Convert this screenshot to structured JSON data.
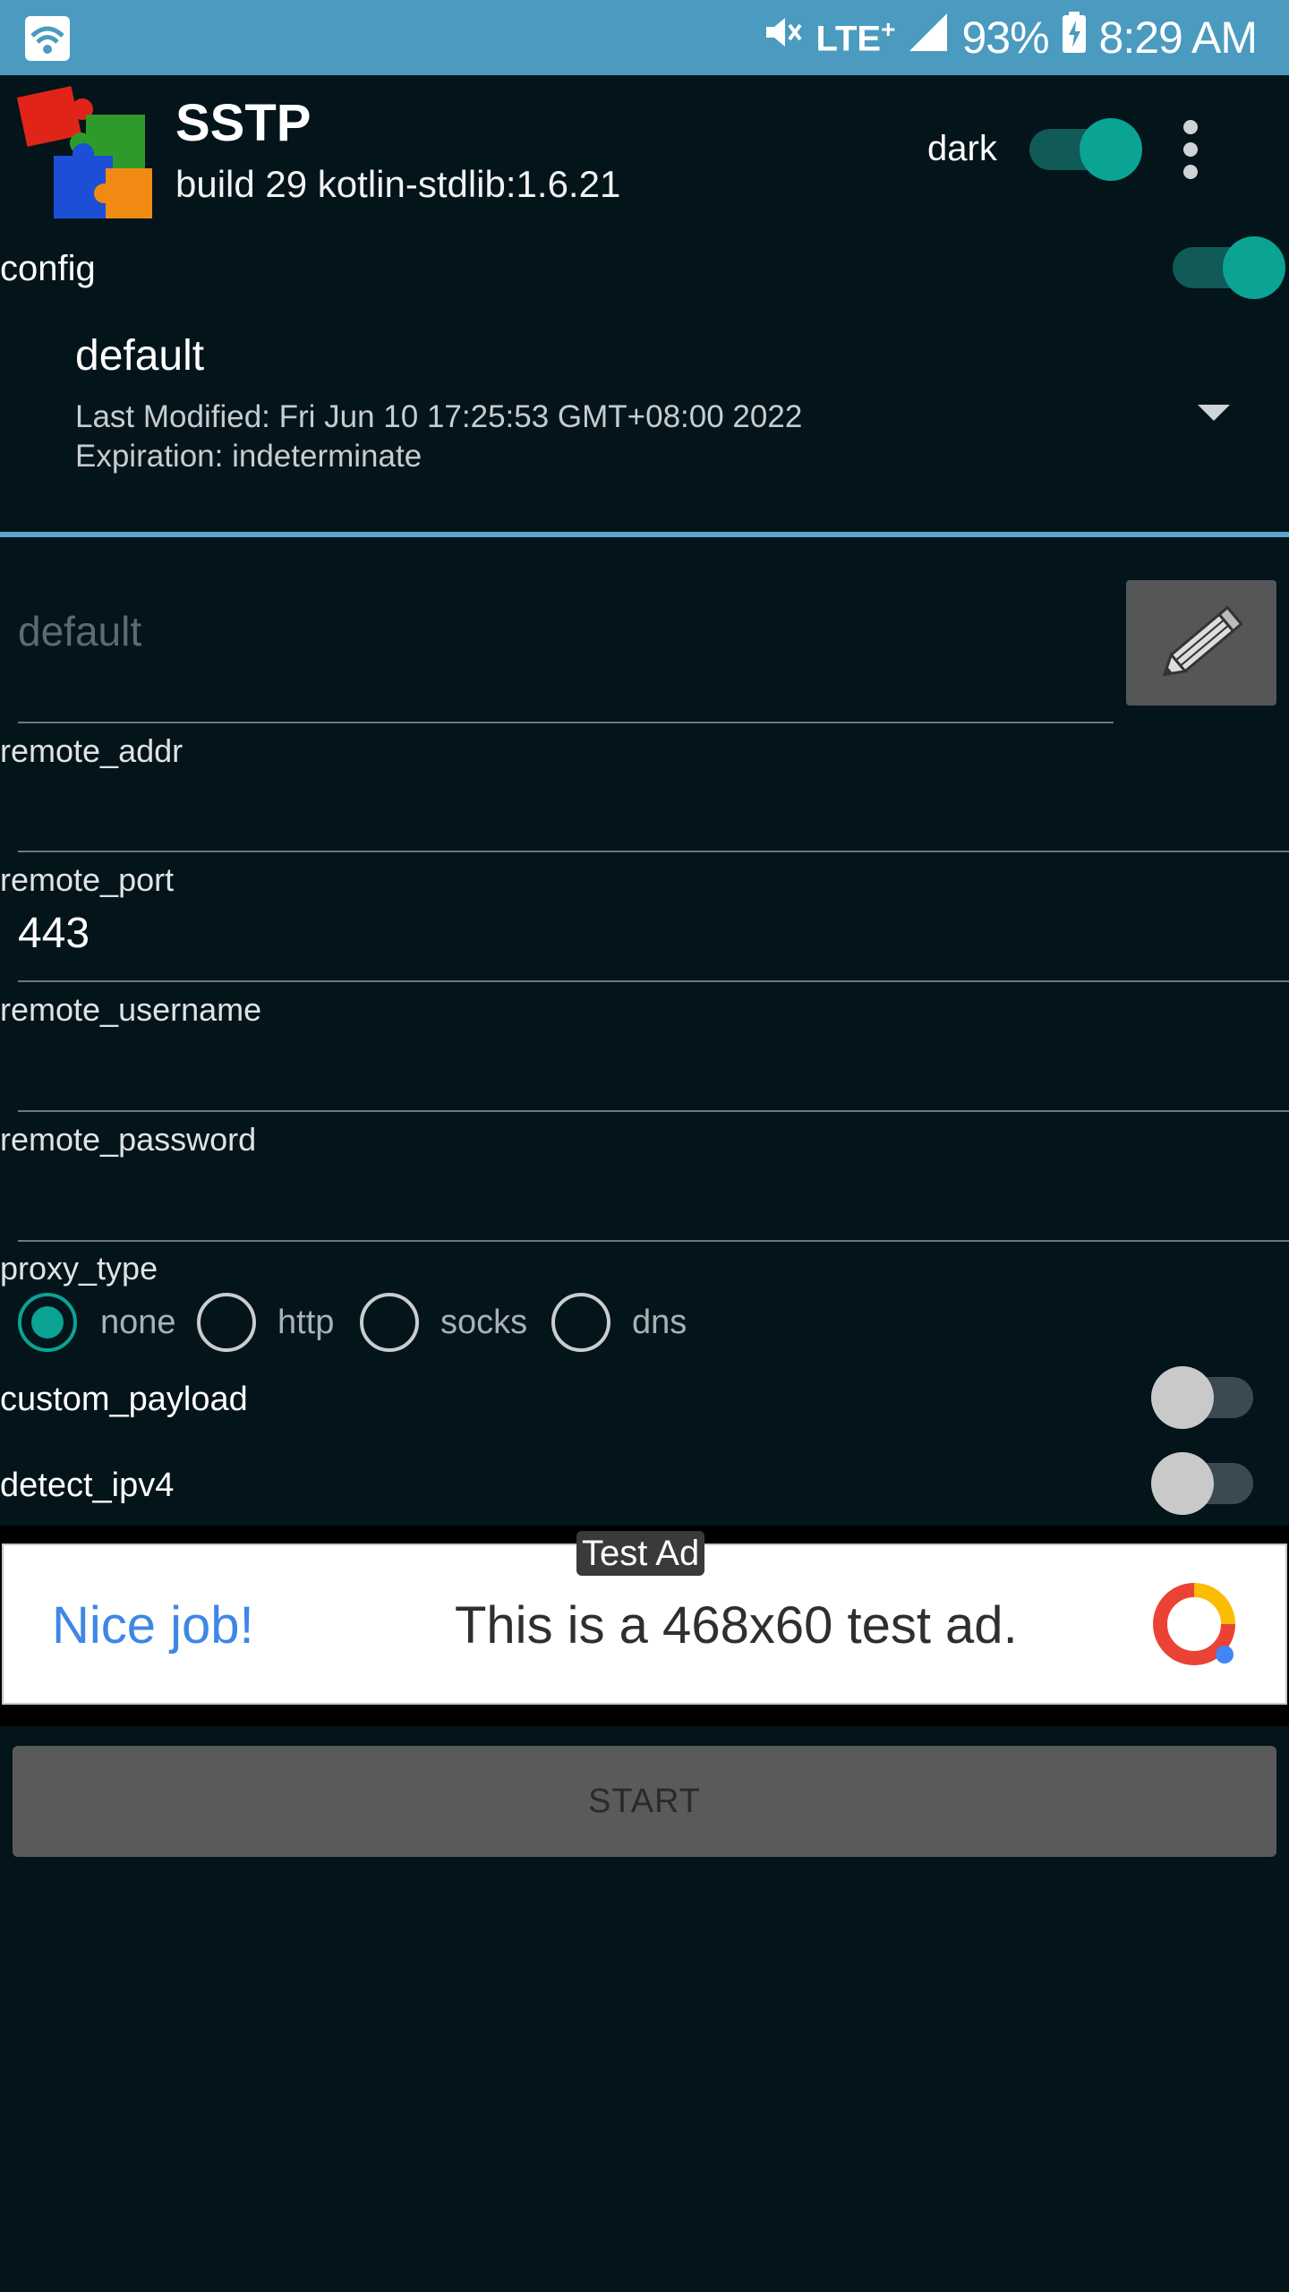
{
  "status_bar": {
    "battery": "93%",
    "time": "8:29 AM",
    "network": "LTE",
    "network_plus": "+"
  },
  "header": {
    "title": "SSTP",
    "subtitle": "build 29 kotlin-stdlib:1.6.21",
    "dark_label": "dark",
    "dark_on": true
  },
  "config": {
    "label": "config",
    "toggle_on": true,
    "name": "default",
    "last_modified": "Last Modified: Fri Jun 10 17:25:53 GMT+08:00 2022",
    "expiration": "Expiration: indeterminate"
  },
  "name_field": {
    "placeholder": "default"
  },
  "fields": {
    "remote_addr": {
      "label": "remote_addr",
      "value": ""
    },
    "remote_port": {
      "label": "remote_port",
      "value": "443"
    },
    "remote_username": {
      "label": "remote_username",
      "value": ""
    },
    "remote_password": {
      "label": "remote_password",
      "value": ""
    }
  },
  "proxy": {
    "label": "proxy_type",
    "options": [
      "none",
      "http",
      "socks",
      "dns"
    ],
    "selected": "none"
  },
  "switches": {
    "custom_payload": {
      "label": "custom_payload",
      "on": false
    },
    "detect_ipv4": {
      "label": "detect_ipv4",
      "on": false
    }
  },
  "ad": {
    "badge": "Test Ad",
    "headline": "Nice job!",
    "body": "This is a 468x60 test ad."
  },
  "start_label": "START",
  "colors": {
    "accent": "#0aa394",
    "status_bar": "#4a9bbf",
    "background": "#03141b",
    "divider": "#5aa6cc"
  }
}
